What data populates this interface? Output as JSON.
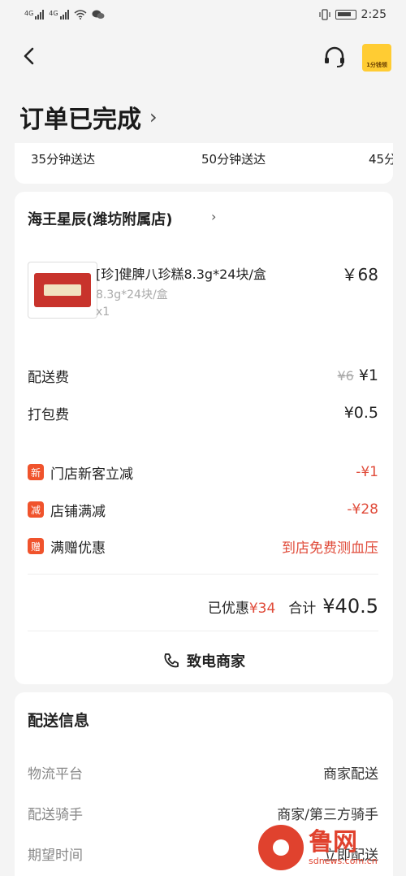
{
  "status_bar": {
    "network_1": "4G",
    "network_2": "4G",
    "time": "2:25"
  },
  "icons": {
    "back": "back-arrow-icon",
    "service": "headset-icon",
    "coupon": "coupon-icon"
  },
  "header": {
    "title": "订单已完成",
    "coupon_label": "1分钱领"
  },
  "delivery_times": [
    "35分钟送达",
    "50分钟送达",
    "45分"
  ],
  "shop": {
    "name": "海王星辰(潍坊附属店)"
  },
  "product": {
    "name": "[珍]健脾八珍糕8.3g*24块/盒",
    "spec": "8.3g*24块/盒",
    "qty": "x1",
    "price": "￥68"
  },
  "fees": {
    "delivery_label": "配送费",
    "delivery_original": "¥6",
    "delivery_price": "¥1",
    "packing_label": "打包费",
    "packing_price": "¥0.5"
  },
  "discounts": [
    {
      "tag": "新",
      "label": "门店新客立减",
      "value": "-¥1"
    },
    {
      "tag": "减",
      "label": "店铺满减",
      "value": "-¥28"
    },
    {
      "tag": "赠",
      "label": "满赠优惠",
      "value": "到店免费测血压"
    }
  ],
  "summary": {
    "saved_label": "已优惠",
    "saved_value": "¥34",
    "total_label": "合计",
    "total_value": "¥40.5"
  },
  "call_merchant": "致电商家",
  "delivery_info": {
    "title": "配送信息",
    "rows": [
      {
        "key": "物流平台",
        "value": "商家配送"
      },
      {
        "key": "配送骑手",
        "value": "商家/第三方骑手"
      },
      {
        "key": "期望时间",
        "value": "立即配送"
      }
    ]
  },
  "watermark": {
    "name": "鲁网",
    "url": "sdnews.com.cn"
  },
  "colors": {
    "accent_red": "#e04b3a",
    "tag_orange": "#f0532c",
    "background": "#f4f4f4"
  }
}
